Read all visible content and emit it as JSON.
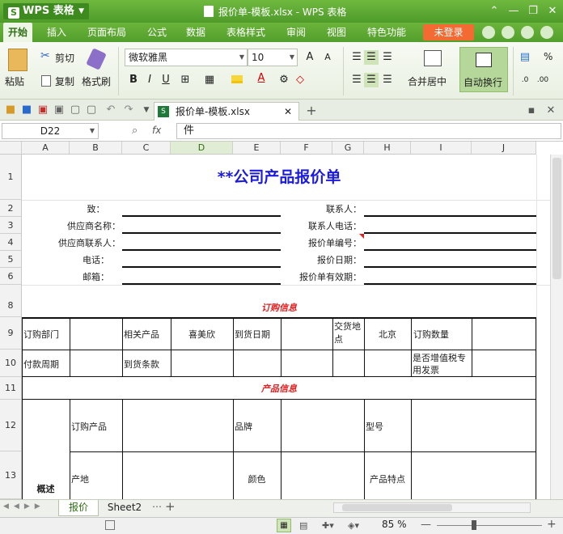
{
  "titlebar": {
    "app_name": "WPS 表格",
    "document_title": "报价单-模板.xlsx - WPS 表格"
  },
  "menubar": {
    "items": [
      "开始",
      "插入",
      "页面布局",
      "公式",
      "数据",
      "表格样式",
      "审阅",
      "视图",
      "特色功能"
    ],
    "login_label": "未登录"
  },
  "ribbon": {
    "paste": "粘贴",
    "cut": "剪切",
    "copy": "复制",
    "format_painter": "格式刷",
    "font_name": "微软雅黑",
    "font_size": "10",
    "merge_center": "合并居中",
    "wrap_text": "自动换行",
    "percent": "%"
  },
  "tabs": {
    "file": "报价单-模板.xlsx"
  },
  "formula_bar": {
    "name_box": "D22",
    "fx": "fx",
    "value": "件"
  },
  "columns": [
    "A",
    "B",
    "C",
    "D",
    "E",
    "F",
    "G",
    "H",
    "I",
    "J"
  ],
  "rows": [
    "1",
    "2",
    "3",
    "4",
    "5",
    "6",
    "8",
    "9",
    "10",
    "11",
    "12",
    "13"
  ],
  "sheet": {
    "title": "**公司产品报价单",
    "to": "致：",
    "contact": "联系人：",
    "supplier_name": "供应商名称：",
    "contact_phone": "联系人电话：",
    "supplier_contact": "供应商联系人：",
    "quote_no": "报价单编号：",
    "phone": "电话：",
    "quote_date": "报价日期：",
    "email": "邮箱：",
    "quote_validity": "报价单有效期：",
    "section_order": "订购信息",
    "order_dept": "订购部门",
    "related_product": "相关产品",
    "product_value": "喜美欣",
    "delivery_date": "到货日期",
    "delivery_place": "交货地点",
    "place_value": "北京",
    "order_qty": "订购数量",
    "payment_cycle": "付款周期",
    "delivery_terms": "到货条款",
    "vat_invoice": "是否增值税专用发票",
    "section_product": "产品信息",
    "overview": "概述",
    "order_product": "订购产品",
    "brand": "品牌",
    "model": "型号",
    "origin": "产地",
    "color": "颜色",
    "features": "产品特点"
  },
  "sheet_tabs": [
    "报价",
    "Sheet2"
  ],
  "status": {
    "zoom": "85 %"
  }
}
